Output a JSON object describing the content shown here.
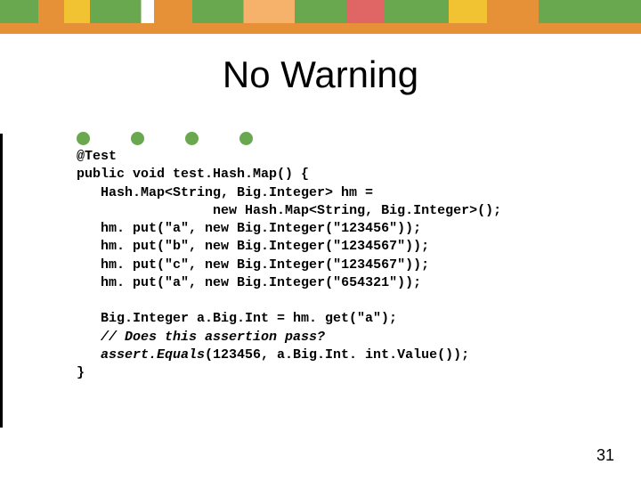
{
  "title": "No Warning",
  "code": {
    "l1": "@Test",
    "l2a": "public void",
    "l2b": " test.Hash.Map() {",
    "l3": "   Hash.Map<String, Big.Integer> hm =",
    "l4a": "                 ",
    "l4b": "new",
    "l4c": " Hash.Map<String, Big.Integer>();",
    "l5a": "   hm. put(\"a\", ",
    "l5b": "new",
    "l5c": " Big.Integer(\"123456\"));",
    "l6a": "   hm. put(\"b\", ",
    "l6b": "new",
    "l6c": " Big.Integer(\"1234567\"));",
    "l7a": "   hm. put(\"c\", ",
    "l7b": "new",
    "l7c": " Big.Integer(\"1234567\"));",
    "l8a": "   hm. put(\"a\", ",
    "l8b": "new",
    "l8c": " Big.Integer(\"654321\"));",
    "blank": "",
    "l9": "   Big.Integer a.Big.Int = hm. get(\"a\");",
    "l10": "   // Does this assertion pass?",
    "l11a": "   assert.Equals",
    "l11b": "(123456, a.Big.Int. int.Value());",
    "l12": "}"
  },
  "page_number": "31"
}
